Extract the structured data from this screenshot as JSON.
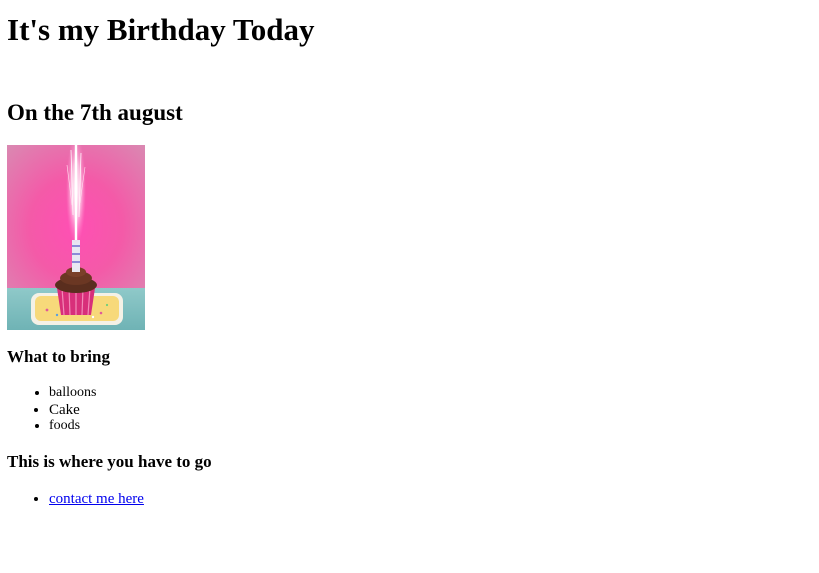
{
  "page": {
    "title": "It's my Birthday Today",
    "date_heading": "On the 7th august"
  },
  "photo": {
    "alt": "cupcake with sparkler candle"
  },
  "bring": {
    "heading": "What to bring",
    "items": [
      "balloons",
      "Cake",
      "foods"
    ]
  },
  "location": {
    "heading": "This is where you have to go",
    "link_text": "contact me here"
  },
  "colors": {
    "link": "#0000ee",
    "text": "#000000",
    "background": "#ffffff"
  }
}
